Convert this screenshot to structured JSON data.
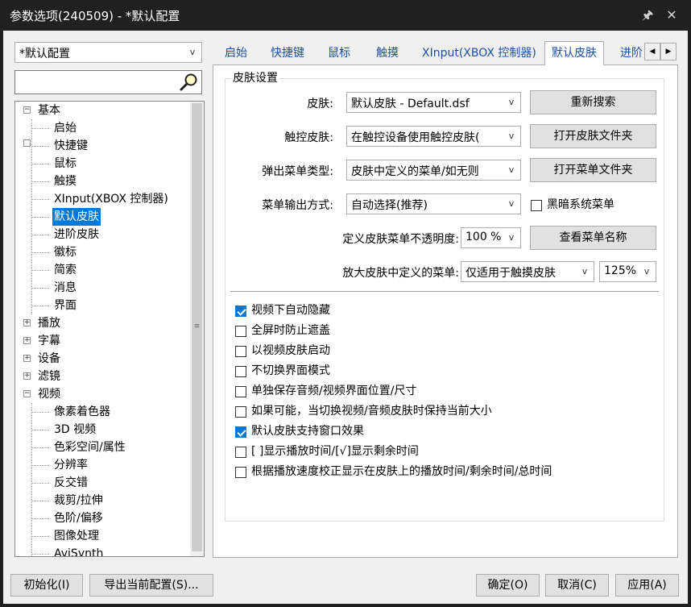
{
  "window": {
    "title": "参数选项(240509) - *默认配置",
    "pin_glyph": "🖈",
    "close_glyph": "✕"
  },
  "profile": {
    "value": "*默认配置"
  },
  "search": {
    "value": ""
  },
  "tree": {
    "items": [
      {
        "label": "基本",
        "expander": "−"
      },
      {
        "label": "启始"
      },
      {
        "label": "快捷键"
      },
      {
        "label": "鼠标"
      },
      {
        "label": "触摸"
      },
      {
        "label": "XInput(XBOX 控制器)"
      },
      {
        "label": "默认皮肤"
      },
      {
        "label": "进阶皮肤"
      },
      {
        "label": "徽标"
      },
      {
        "label": "简索"
      },
      {
        "label": "消息"
      },
      {
        "label": "界面"
      },
      {
        "label": "播放",
        "expander": "+"
      },
      {
        "label": "字幕",
        "expander": "+"
      },
      {
        "label": "设备",
        "expander": "+"
      },
      {
        "label": "滤镜",
        "expander": "+"
      },
      {
        "label": "视频",
        "expander": "−"
      },
      {
        "label": "像素着色器"
      },
      {
        "label": "3D 视频"
      },
      {
        "label": "色彩空间/属性"
      },
      {
        "label": "分辨率"
      },
      {
        "label": "反交错"
      },
      {
        "label": "裁剪/拉伸"
      },
      {
        "label": "色阶/偏移"
      },
      {
        "label": "图像处理"
      },
      {
        "label": "AviSynth"
      }
    ],
    "scroll_grip": "≡"
  },
  "tabs": [
    {
      "label": "启始"
    },
    {
      "label": "快捷键"
    },
    {
      "label": "鼠标"
    },
    {
      "label": "触摸"
    },
    {
      "label": "XInput(XBOX 控制器)"
    },
    {
      "label": "默认皮肤"
    },
    {
      "label": "进阶"
    }
  ],
  "tab_scroll": {
    "left": "◀",
    "right": "▶"
  },
  "skin": {
    "group_title": "皮肤设置",
    "skin_label": "皮肤:",
    "skin_value": "默认皮肤 - Default.dsf",
    "touch_label": "触控皮肤:",
    "touch_value": "在触控设备使用触控皮肤(",
    "popup_label": "弹出菜单类型:",
    "popup_value": "皮肤中定义的菜单/如无则",
    "menu_out_label": "菜单输出方式:",
    "menu_out_value": "自动选择(推荐)",
    "opacity_label": "定义皮肤菜单不透明度:",
    "opacity_value": "100 %",
    "enlarge_label": "放大皮肤中定义的菜单:",
    "enlarge_value": "仅适用于触摸皮肤",
    "enlarge_pct": "125%",
    "btn_research": "重新搜索",
    "btn_open_skin": "打开皮肤文件夹",
    "btn_open_menu": "打开菜单文件夹",
    "btn_view_menu": "查看菜单名称",
    "dark_menu_label": "黑暗系统菜单",
    "dark_menu_checked": false
  },
  "options": [
    {
      "label": "视频下自动隐藏",
      "checked": true
    },
    {
      "label": "全屏时防止遮盖",
      "checked": false
    },
    {
      "label": "以视频皮肤启动",
      "checked": false
    },
    {
      "label": "不切换界面模式",
      "checked": false
    },
    {
      "label": "单独保存音频/视频界面位置/尺寸",
      "checked": false
    },
    {
      "label": "如果可能，当切换视频/音频皮肤时保持当前大小",
      "checked": false
    },
    {
      "label": "默认皮肤支持窗口效果",
      "checked": true
    },
    {
      "label": "[ ]显示播放时间/[√]显示剩余时间",
      "checked": false
    },
    {
      "label": "根据播放速度校正显示在皮肤上的播放时间/剩余时间/总时间",
      "checked": false
    }
  ],
  "footer": {
    "init": "初始化(I)",
    "export": "导出当前配置(S)...",
    "ok": "确定(O)",
    "cancel": "取消(C)",
    "apply": "应用(A)"
  },
  "colors": {
    "accent": "#0078d7",
    "titlebar": "#202020",
    "tab_text": "#1d4fa3"
  }
}
